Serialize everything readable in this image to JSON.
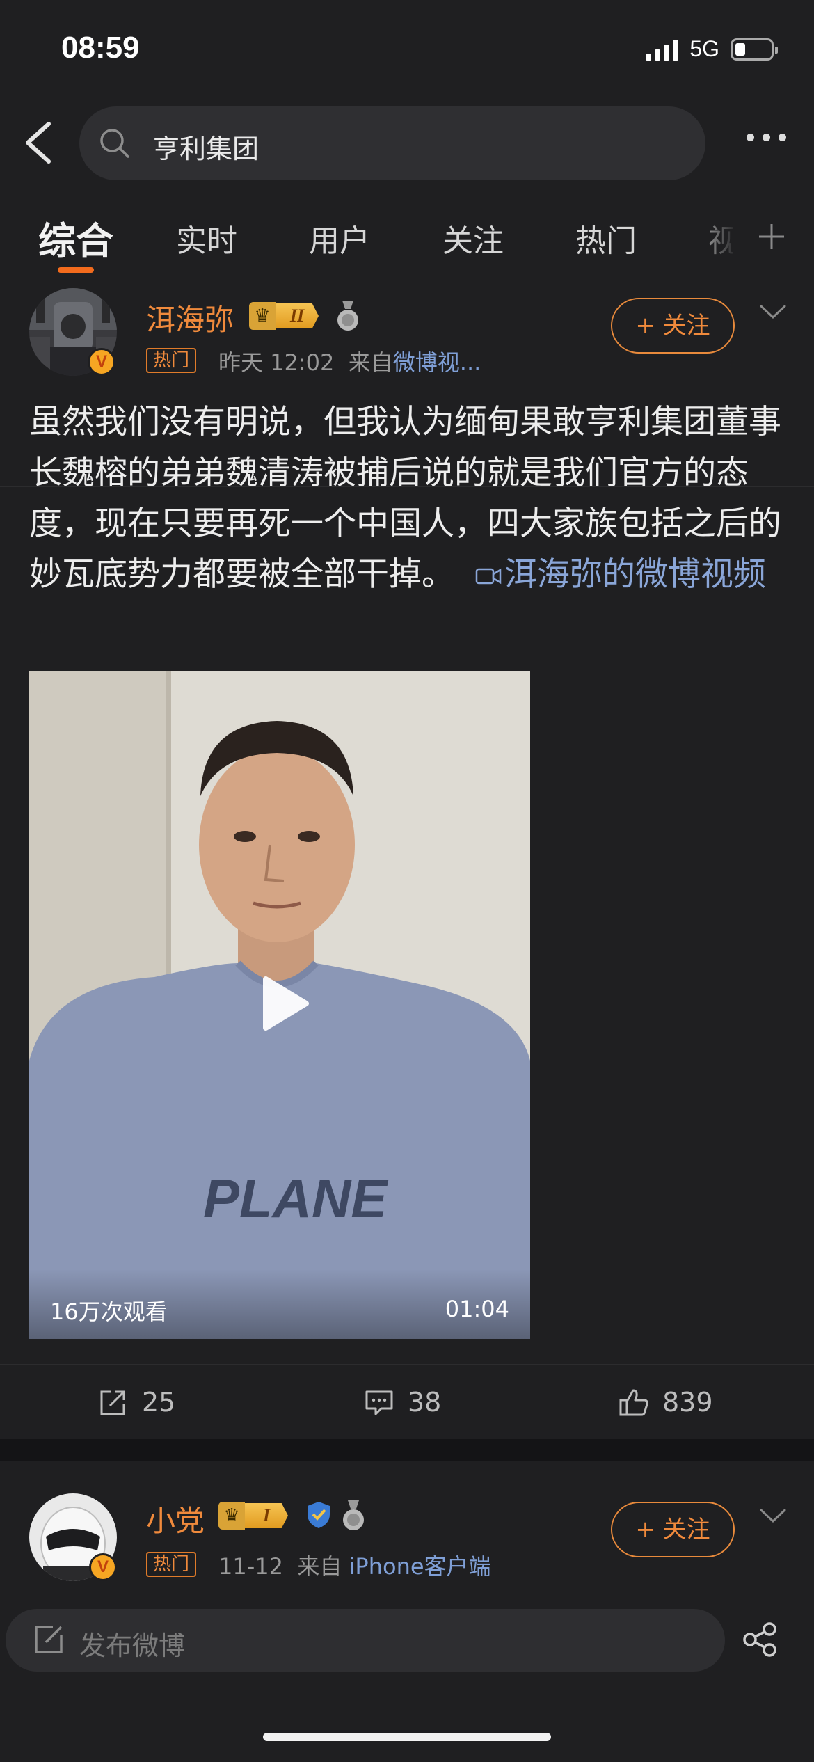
{
  "status_bar": {
    "time": "08:59",
    "network": "5G"
  },
  "search": {
    "query": "亨利集团"
  },
  "tabs": [
    {
      "label": "综合"
    },
    {
      "label": "实时"
    },
    {
      "label": "用户"
    },
    {
      "label": "关注"
    },
    {
      "label": "热门"
    },
    {
      "label": "视"
    }
  ],
  "posts": [
    {
      "username": "洱海弥",
      "level": "II",
      "hot_tag": "热门",
      "time": "昨天 12:02",
      "source_prefix": "来自",
      "source": "微博视...",
      "follow_label": "+ 关注",
      "text": "虽然我们没有明说，但我认为缅甸果敢亨利集团董事长魏榕的弟弟魏清涛被捕后说的就是我们官方的态度，现在只要再死一个中国人，四大家族包括之后的妙瓦底势力都要被全部干掉。",
      "video_link": "洱海弥的微博视频",
      "video": {
        "views": "16万次观看",
        "duration": "01:04",
        "shirt_text": "PLANE"
      },
      "actions": {
        "reposts": "25",
        "comments": "38",
        "likes": "839"
      }
    },
    {
      "username": "小党",
      "level": "I",
      "hot_tag": "热门",
      "time": "11-12",
      "source_prefix": "来自",
      "source": "iPhone客户端",
      "follow_label": "+ 关注"
    }
  ],
  "compose": {
    "placeholder": "发布微博"
  },
  "colors": {
    "accent": "#f26b1d",
    "username": "#f08a3c",
    "link": "#8aa6d8",
    "background": "#1f1f21"
  }
}
